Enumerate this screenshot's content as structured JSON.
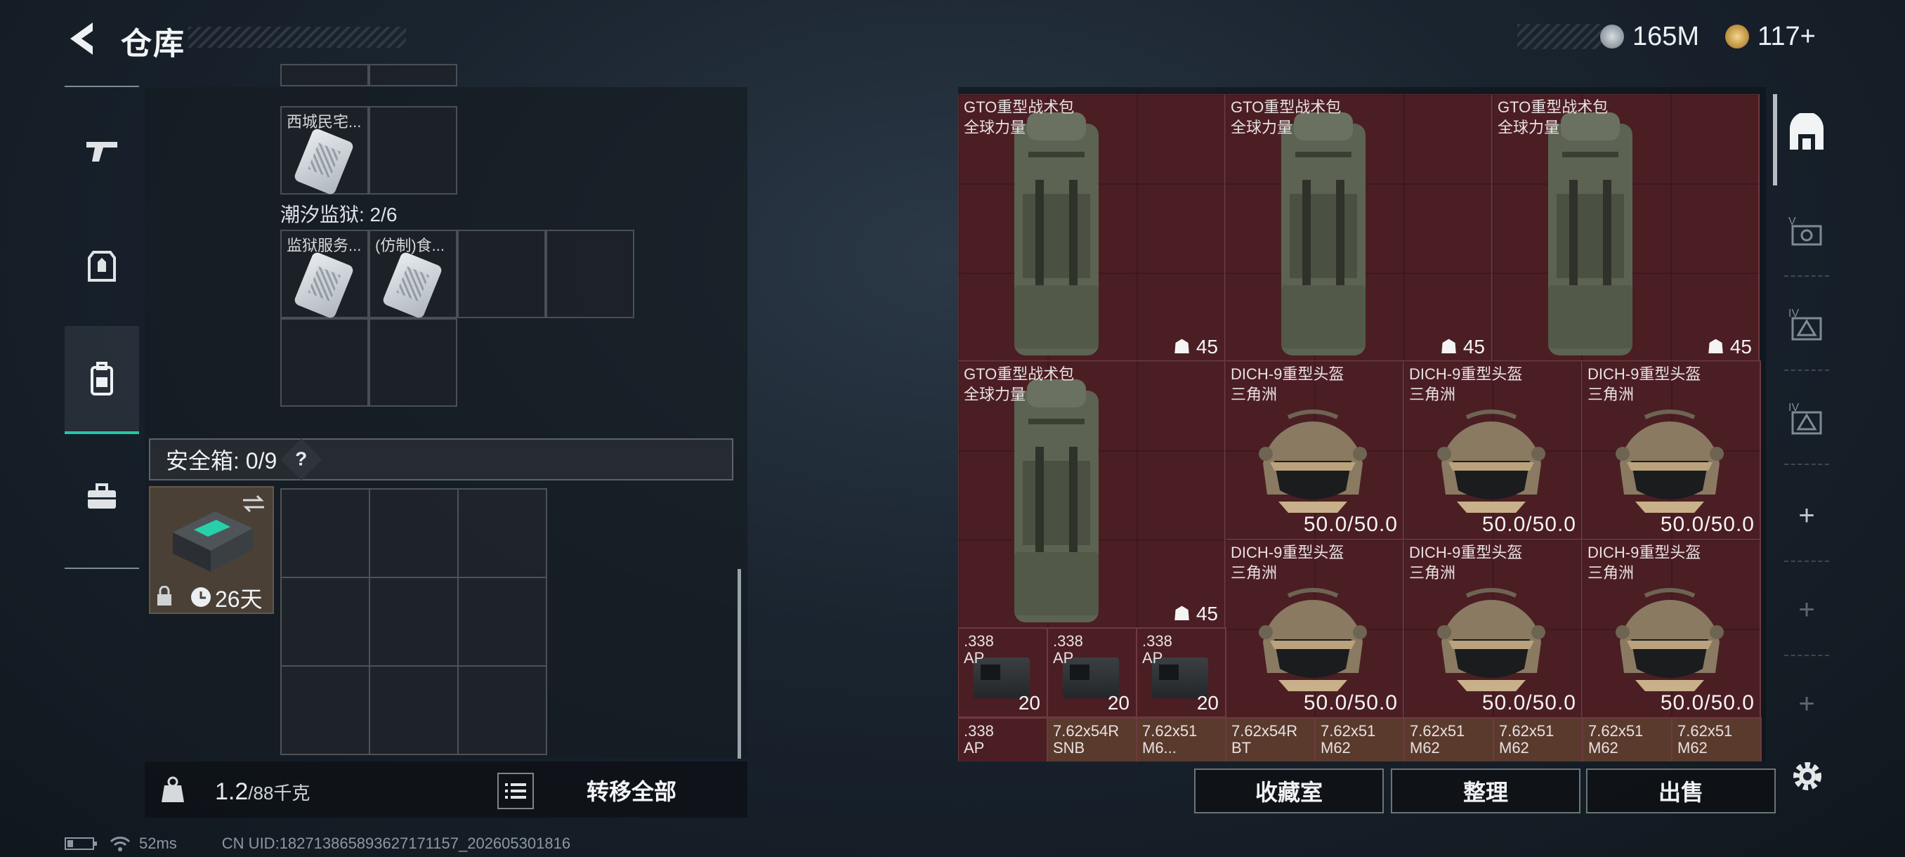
{
  "header": {
    "title": "仓库",
    "money": "165M",
    "tokens": "117+"
  },
  "colors": {
    "accent": "#25c7a6",
    "item_bg": "#4b1e24"
  },
  "left_rail": {
    "items": [
      "gun-icon",
      "armor-icon",
      "backpack-icon",
      "toolbox-icon"
    ],
    "active": "backpack-icon"
  },
  "loadout": {
    "top_cell": {
      "label": "西城民宅..."
    },
    "prison_label": "潮汐监狱: 2/6",
    "prison_cells": [
      {
        "label": "监狱服务..."
      },
      {
        "label": "(仿制)食..."
      }
    ],
    "safe_label": "安全箱: 0/9",
    "safe_help": "?",
    "safe_timer": "26天"
  },
  "bottom_left": {
    "weight": "1.2",
    "weight_max": "/88千克",
    "transfer_all": "转移全部"
  },
  "stash": {
    "backpacks": [
      {
        "name": "GTO重型战术包",
        "sub": "全球力量",
        "count": "45"
      },
      {
        "name": "GTO重型战术包",
        "sub": "全球力量",
        "count": "45"
      },
      {
        "name": "GTO重型战术包",
        "sub": "全球力量",
        "count": "45"
      },
      {
        "name": "GTO重型战术包",
        "sub": "全球力量",
        "count": "45"
      }
    ],
    "helmets": [
      {
        "name": "DICH-9重型头盔",
        "sub": "三角洲",
        "durability": "50.0/50.0"
      },
      {
        "name": "DICH-9重型头盔",
        "sub": "三角洲",
        "durability": "50.0/50.0"
      },
      {
        "name": "DICH-9重型头盔",
        "sub": "三角洲",
        "durability": "50.0/50.0"
      },
      {
        "name": "DICH-9重型头盔",
        "sub": "三角洲",
        "durability": "50.0/50.0"
      },
      {
        "name": "DICH-9重型头盔",
        "sub": "三角洲",
        "durability": "50.0/50.0"
      },
      {
        "name": "DICH-9重型头盔",
        "sub": "三角洲",
        "durability": "50.0/50.0"
      }
    ],
    "ammo_row1": [
      {
        "name": ".338",
        "sub": "AP",
        "count": "20"
      },
      {
        "name": ".338",
        "sub": "AP",
        "count": "20"
      },
      {
        "name": ".338",
        "sub": "AP",
        "count": "20"
      }
    ],
    "ammo_row2": [
      {
        "name": ".338",
        "sub": "AP"
      },
      {
        "name": "7.62x54R",
        "sub": "SNB"
      },
      {
        "name": "7.62x51",
        "sub": "M6..."
      },
      {
        "name": "7.62x54R",
        "sub": "BT"
      },
      {
        "name": "7.62x51",
        "sub": "M62"
      },
      {
        "name": "7.62x51",
        "sub": "M62"
      },
      {
        "name": "7.62x51",
        "sub": "M62"
      },
      {
        "name": "7.62x51",
        "sub": "M62"
      },
      {
        "name": "7.62x51",
        "sub": "M62"
      }
    ]
  },
  "right_rail": {
    "items": [
      "stash-icon",
      "v-category-icon",
      "iv-category-icon",
      "iv-category-icon-2",
      "plus-icon",
      "plus-icon",
      "plus-icon"
    ]
  },
  "bottom_right": {
    "collection": "收藏室",
    "sort": "整理",
    "sell": "出售"
  },
  "status": {
    "ping": "52ms",
    "uid": "CN UID:182713865893627171157_202605301816"
  }
}
